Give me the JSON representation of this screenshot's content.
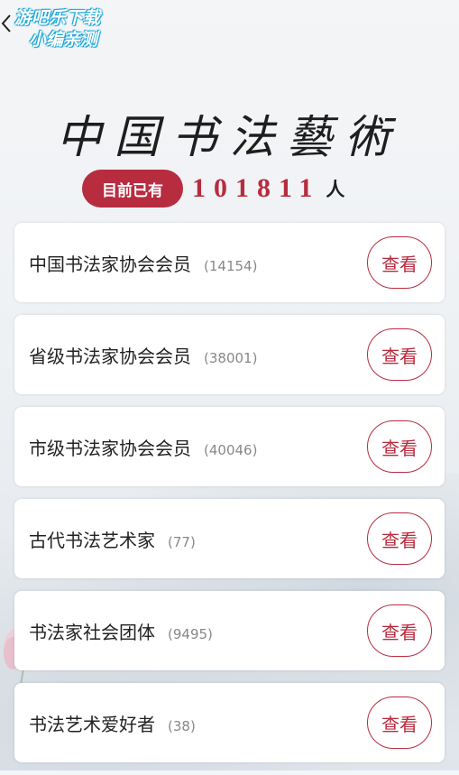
{
  "header": {
    "watermark_line1": "游吧乐下载",
    "watermark_line2": "小编亲测",
    "title": "中国书法藝術"
  },
  "counter": {
    "badge": "目前已有",
    "number": "101811",
    "unit": "人"
  },
  "categories": [
    {
      "name": "中国书法家协会会员",
      "count": "(14154)",
      "button": "查看"
    },
    {
      "name": "省级书法家协会会员",
      "count": "(38001)",
      "button": "查看"
    },
    {
      "name": "市级书法家协会会员",
      "count": "(40046)",
      "button": "查看"
    },
    {
      "name": "古代书法艺术家",
      "count": "(77)",
      "button": "查看"
    },
    {
      "name": "书法家社会团体",
      "count": "(9495)",
      "button": "查看"
    },
    {
      "name": "书法艺术爱好者",
      "count": "(38)",
      "button": "查看"
    }
  ],
  "colors": {
    "accent": "#b72c3f",
    "watermark": "#1aa7d8"
  }
}
